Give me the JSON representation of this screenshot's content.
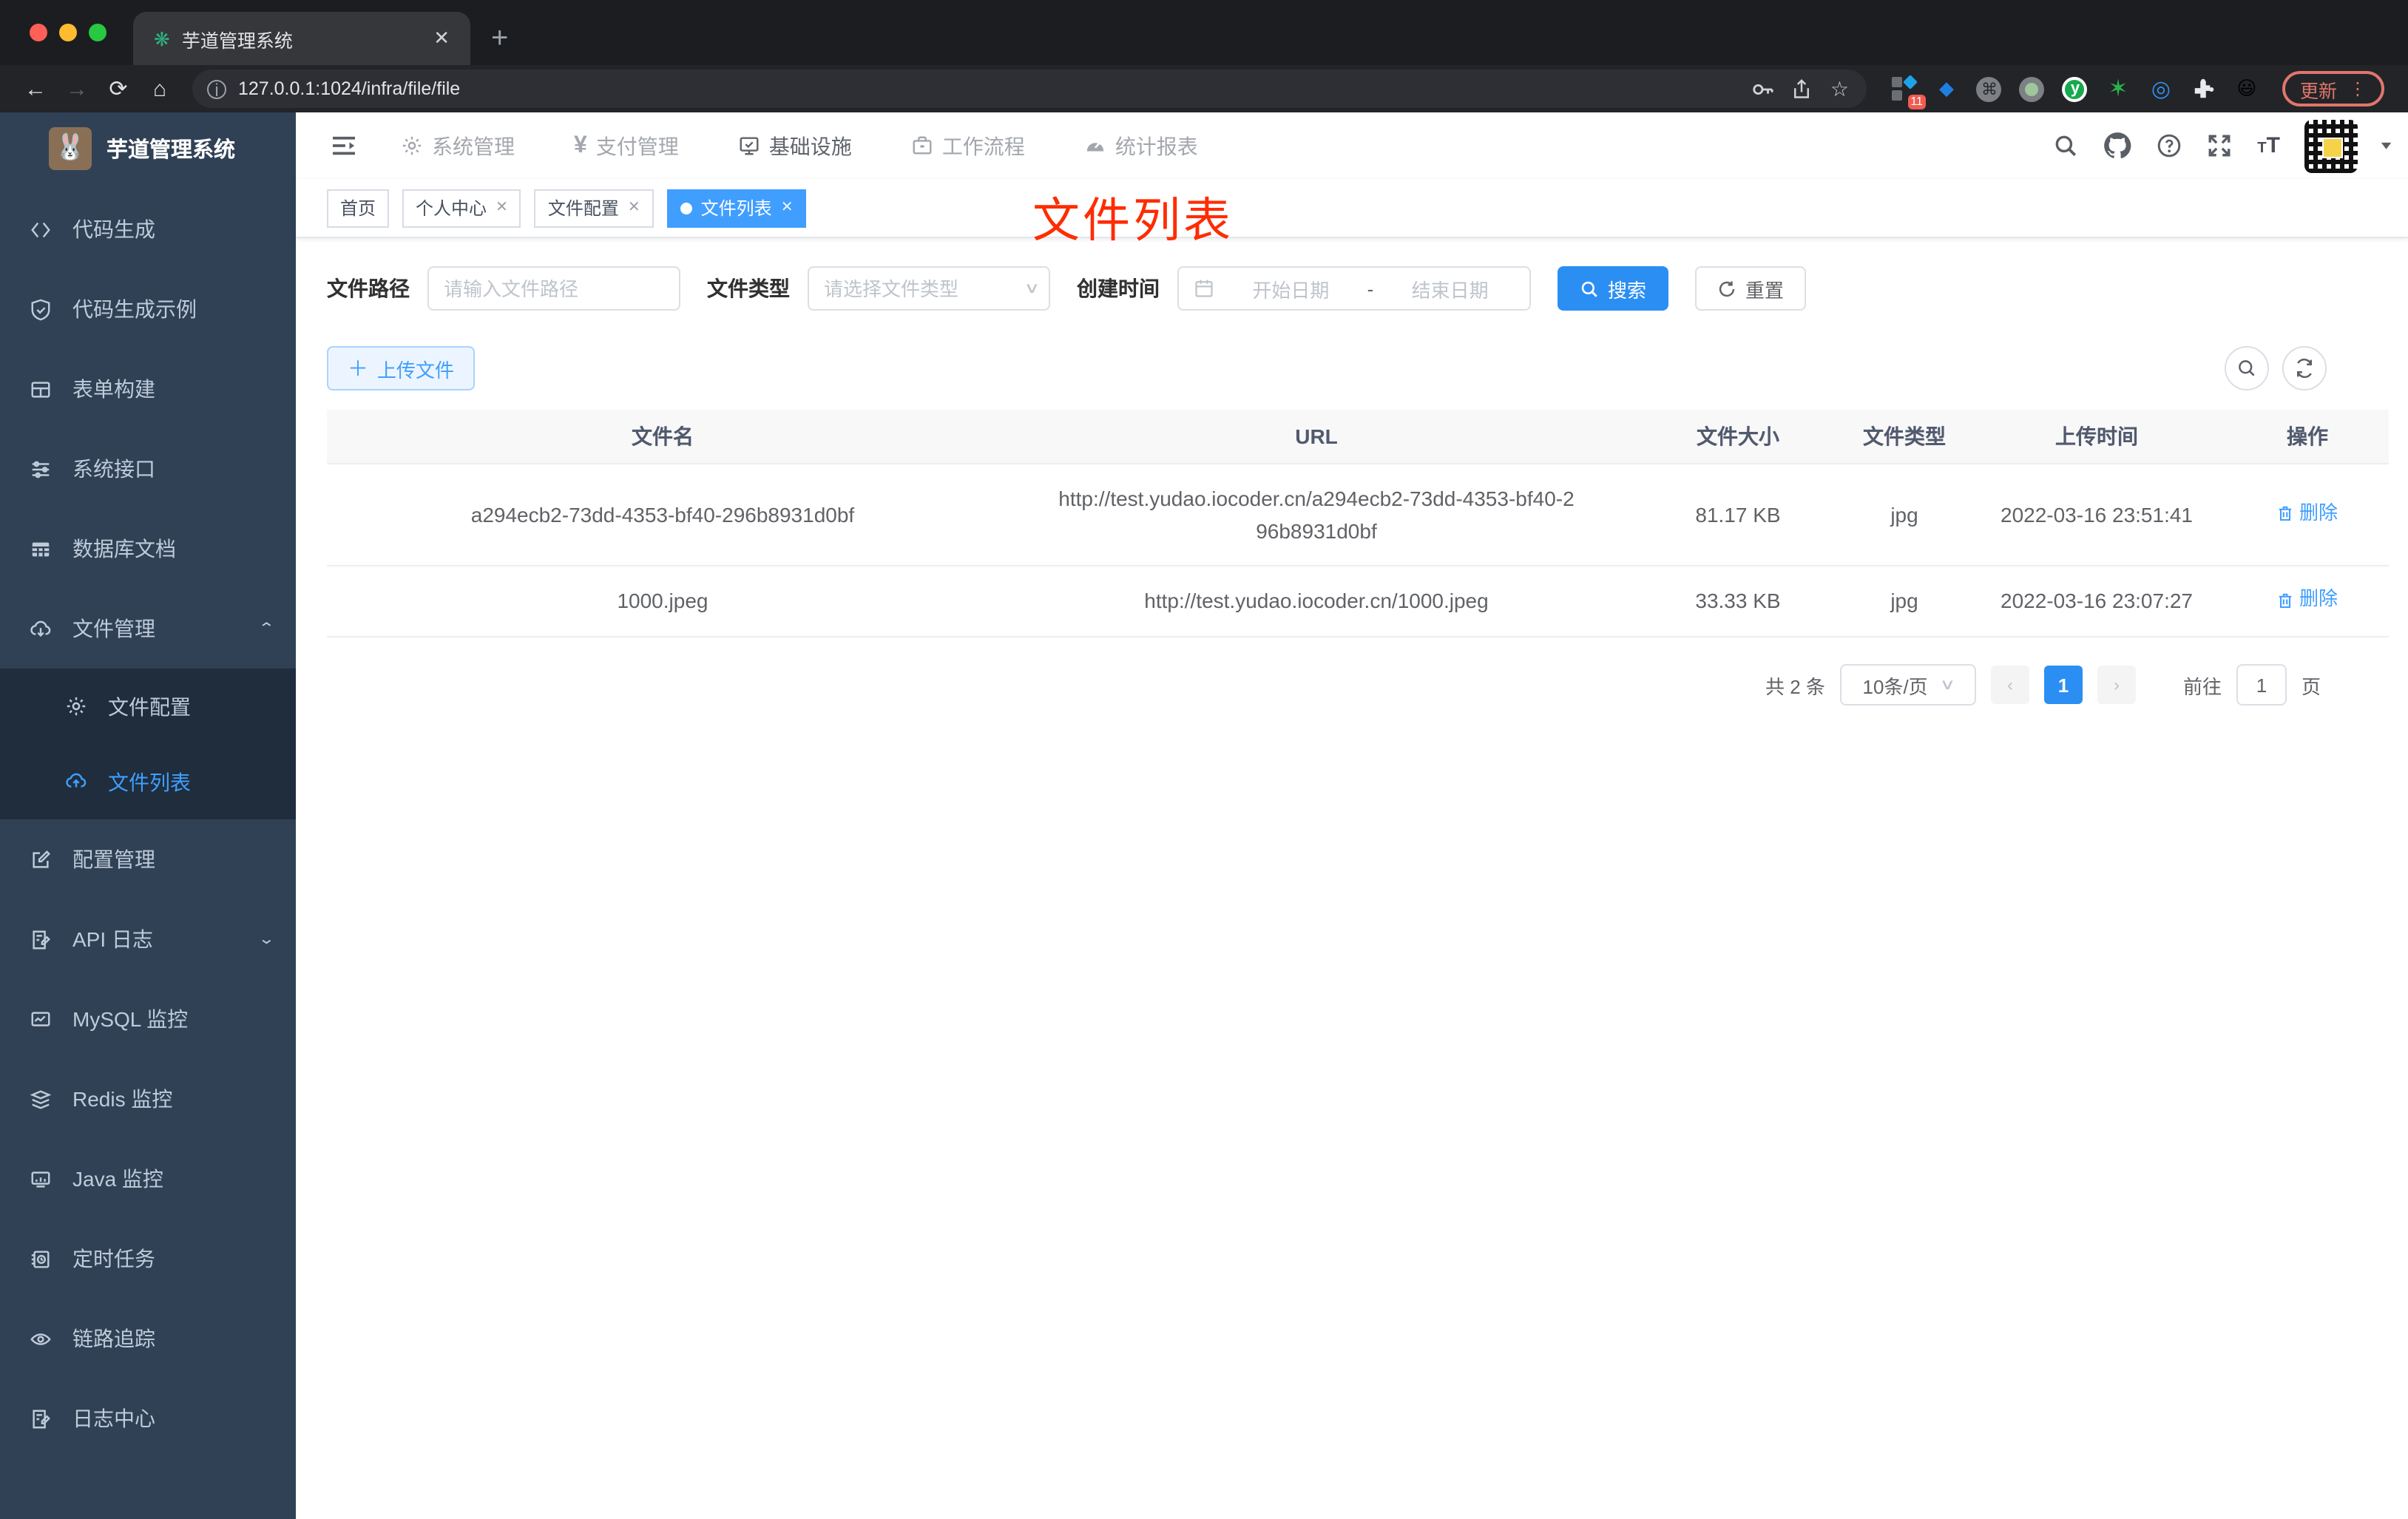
{
  "colors": {
    "accent": "#409eff",
    "annotation_red": "#fe2c00",
    "sidebar_bg": "#304156",
    "submenu_bg": "#1f2d3d"
  },
  "browser": {
    "tab_title": "芋道管理系统",
    "url": "127.0.0.1:1024/infra/file/file",
    "update_label": "更新",
    "extension_badge": "11",
    "ext_y_letter": "y",
    "cmd_glyph": "⌘"
  },
  "sidebar": {
    "title": "芋道管理系统",
    "items": [
      {
        "label": "代码生成"
      },
      {
        "label": "代码生成示例"
      },
      {
        "label": "表单构建"
      },
      {
        "label": "系统接口"
      },
      {
        "label": "数据库文档"
      },
      {
        "label": "文件管理"
      },
      {
        "label": "文件配置"
      },
      {
        "label": "文件列表"
      },
      {
        "label": "配置管理"
      },
      {
        "label": "API 日志"
      },
      {
        "label": "MySQL 监控"
      },
      {
        "label": "Redis 监控"
      },
      {
        "label": "Java 监控"
      },
      {
        "label": "定时任务"
      },
      {
        "label": "链路追踪"
      },
      {
        "label": "日志中心"
      }
    ]
  },
  "header": {
    "nav": [
      {
        "label": "系统管理"
      },
      {
        "label": "支付管理"
      },
      {
        "label": "基础设施"
      },
      {
        "label": "工作流程"
      },
      {
        "label": "统计报表"
      }
    ],
    "yen_glyph": "¥",
    "font_size_glyph": "T"
  },
  "tags": [
    {
      "label": "首页"
    },
    {
      "label": "个人中心"
    },
    {
      "label": "文件配置"
    },
    {
      "label": "文件列表"
    }
  ],
  "annotation": {
    "text": "文件列表"
  },
  "filters": {
    "path_label": "文件路径",
    "path_placeholder": "请输入文件路径",
    "type_label": "文件类型",
    "type_placeholder": "请选择文件类型",
    "date_label": "创建时间",
    "date_start_placeholder": "开始日期",
    "date_separator": "-",
    "date_end_placeholder": "结束日期",
    "search_label": "搜索",
    "reset_label": "重置"
  },
  "toolbar": {
    "upload_label": "上传文件"
  },
  "table": {
    "headers": [
      "文件名",
      "URL",
      "文件大小",
      "文件类型",
      "上传时间",
      "操作"
    ],
    "rows": [
      {
        "name": "a294ecb2-73dd-4353-bf40-296b8931d0bf",
        "url": "http://test.yudao.iocoder.cn/a294ecb2-73dd-4353-bf40-296b8931d0bf",
        "size": "81.17 KB",
        "type": "jpg",
        "time": "2022-03-16 23:51:41",
        "action": "删除"
      },
      {
        "name": "1000.jpeg",
        "url": "http://test.yudao.iocoder.cn/1000.jpeg",
        "size": "33.33 KB",
        "type": "jpg",
        "time": "2022-03-16 23:07:27",
        "action": "删除"
      }
    ]
  },
  "pagination": {
    "total": "共 2 条",
    "page_size": "10条/页",
    "current": "1",
    "goto_label": "前往",
    "goto_value": "1",
    "page_suffix": "页"
  }
}
